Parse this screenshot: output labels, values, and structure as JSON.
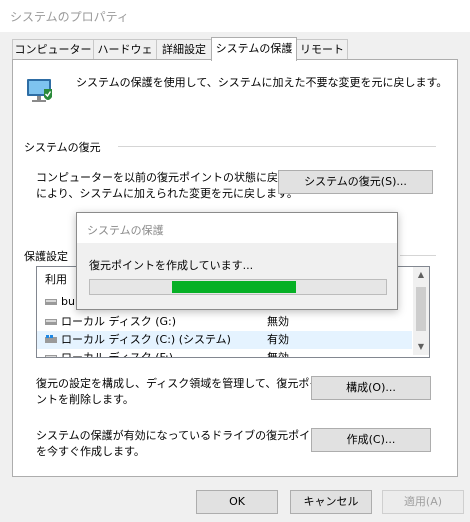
{
  "window": {
    "title": "システムのプロパティ"
  },
  "tabs": [
    {
      "label": "コンピューター名"
    },
    {
      "label": "ハードウェア"
    },
    {
      "label": "詳細設定"
    },
    {
      "label": "システムの保護",
      "active": true
    },
    {
      "label": "リモート"
    }
  ],
  "intro": {
    "text": "システムの保護を使用して、システムに加えた不要な変更を元に戻します。"
  },
  "restore": {
    "heading": "システムの復元",
    "description_line1": "コンピューターを以前の復元ポイントの状態に戻すこと",
    "description_line2": "により、システムに加えられた変更を元に戻します。",
    "button_label": "システムの復元(S)..."
  },
  "protection": {
    "heading": "保護設定",
    "column_drive": "利用",
    "drives": [
      {
        "name": "bu...",
        "status": "...",
        "partially_hidden": true
      },
      {
        "name": "ローカル ディスク (G:)",
        "status": "無効"
      },
      {
        "name": "ローカル ディスク (C:) (システム)",
        "status": "有効",
        "selected": true
      },
      {
        "name": "ローカル ディスク (F:)",
        "status": "無効",
        "partially_hidden": true
      }
    ]
  },
  "configure": {
    "text_line1": "復元の設定を構成し、ディスク領域を管理して、復元ポイ",
    "text_line2": "ントを削除します。",
    "button_label": "構成(O)..."
  },
  "create": {
    "text_line1": "システムの保護が有効になっているドライブの復元ポイント",
    "text_line2": "を今すぐ作成します。",
    "button_label": "作成(C)..."
  },
  "dialog": {
    "title": "システムの保護",
    "message": "復元ポイントを作成しています...",
    "progress_state": "indeterminate (marquee)",
    "progress_color": "#06b025"
  },
  "footer": {
    "ok_label": "OK",
    "cancel_label": "キャンセル",
    "apply_label": "適用(A)"
  },
  "icons": {
    "system_protection": "monitor-shield-icon",
    "drive": "drive-icon",
    "system_drive": "windows-drive-icon",
    "scroll_up": "chevron-up-icon",
    "scroll_down": "chevron-down-icon"
  },
  "colors": {
    "progress": "#06b025",
    "selection": "#e5f3ff",
    "window_bg": "#f0f0f0"
  }
}
